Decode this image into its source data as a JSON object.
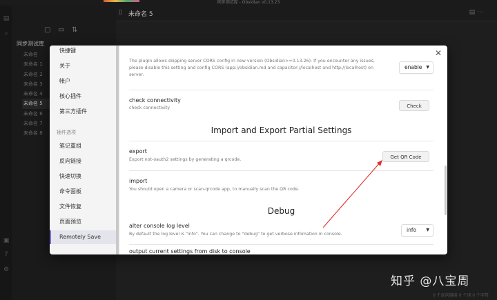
{
  "window": {
    "title": "同步测试库 - Obsidian v0.13.23",
    "status": "0 个反向链接   0 个词   0 个字符"
  },
  "sidebar_files": {
    "vault_name": "同步测试库",
    "files": [
      "未命名",
      "未命名 1",
      "未命名 2",
      "未命名 3",
      "未命名 4",
      "未命名 5",
      "未命名 6",
      "未命名 7",
      "未命名 8"
    ],
    "active_index": 5
  },
  "editor": {
    "tab_title": "未命名 5"
  },
  "settings_nav": {
    "items_top": [
      "快捷键",
      "关于",
      "帐户",
      "核心插件",
      "第三方插件"
    ],
    "plugin_heading": "插件选项",
    "plugin_items": [
      "笔记重组",
      "反向链接",
      "快速切换",
      "命令面板",
      "文件恢复",
      "页面预览",
      "Remotely Save"
    ],
    "selected": "Remotely Save"
  },
  "settings": {
    "cors_desc": "The plugin allows skipping server CORS config in new version (Obsidian>=0.13.26). If you encounter any issues, please disable this setting and config CORS (app://obsidian.md and capacitor://localhost and http://localhost) on server.",
    "cors_value": "enable",
    "check_name": "check connectivity",
    "check_desc": "check connectivity",
    "check_button": "Check",
    "import_export_title": "Import and Export Partial Settings",
    "export_name": "export",
    "export_desc": "Export not-oauth2 settings by generating a qrcode.",
    "export_button": "Get QR Code",
    "import_name": "import",
    "import_desc": "You should open a camera or scan-qrcode app, to manually scan the QR code.",
    "debug_title": "Debug",
    "log_name": "alter console log level",
    "log_desc": "By default the log level is \"info\". You can change to \"debug\" to get verbose infomation in console.",
    "log_value": "info",
    "next_name": "output current settings from disk to console"
  },
  "watermark": "知乎 @八宝周",
  "colors": {
    "accent": "#7b6cd9",
    "annotation_arrow": "#e0302a",
    "modal_bg": "#ffffff",
    "app_bg": "#1e1e1e"
  }
}
